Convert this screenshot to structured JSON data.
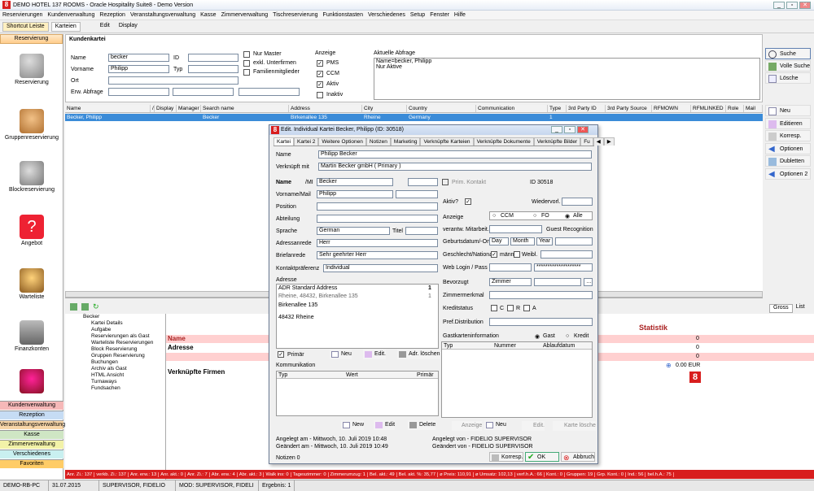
{
  "window": {
    "title": "DEMO HOTEL 137 ROOMS - Oracle Hospitality Suite8 - Demo Version",
    "controls": [
      "_",
      "▫",
      "✕"
    ]
  },
  "menu": [
    "Reservierungen",
    "Kundenverwaltung",
    "Rezeption",
    "Veranstaltungsverwaltung",
    "Kasse",
    "Zimmerverwaltung",
    "Tischreservierung",
    "Funktionstasten",
    "Verschiedenes",
    "Setup",
    "Fenster",
    "Hilfe"
  ],
  "toolbar": {
    "shortcut": "Shortcut Leiste",
    "karteien": "Karteien",
    "edit": "Edit",
    "display": "Display"
  },
  "sidebar": {
    "header": "Reservierung",
    "items": [
      "Reservierung",
      "Gruppenreservierung",
      "Blockreservierung",
      "Angebot",
      "Warteliste",
      "Finanzkonten"
    ],
    "buttons": [
      "Kundenverwaltung",
      "Rezeption",
      "Veranstaltungsverwaltung",
      "Kasse",
      "Zimmerverwaltung",
      "Verschiedenes",
      "Favoriten"
    ],
    "colors": {
      "Kundenverwaltung": "#f6b8b8",
      "Rezeption": "#c6dcf4",
      "Veranstaltungsverwaltung": "#f8d6a8",
      "Kasse": "#cfe6c4",
      "Zimmerverwaltung": "#f2f2a8",
      "Verschiedenes": "#c9f0f0",
      "Favoriten": "#ffcc66"
    }
  },
  "search": {
    "title": "Kundenkartei",
    "name_label": "Name",
    "name_value": "becker",
    "vorname_label": "Vorname",
    "vorname_value": "Philipp",
    "ort_label": "Ort",
    "erw_label": "Erw. Abfrage",
    "id_label": "ID",
    "typ_label": "Typ",
    "nur_master": "Nur Master",
    "exkl_unterfirmen": "exkl. Unterfirmen",
    "familienmitglieder": "Familienmitglieder",
    "anzeige_label": "Anzeige",
    "pms": "PMS",
    "ccm": "CCM",
    "aktiv": "Aktiv",
    "inaktiv": "Inaktiv",
    "aktuelle_label": "Aktuelle Abfrage",
    "aktuelle_line1": "Name=becker, Philipp",
    "aktuelle_line2": "Nur Aktive"
  },
  "right_buttons": [
    "Suche",
    "Volle Suche",
    "Lösche"
  ],
  "right_buttons2": [
    "Neu",
    "Editieren",
    "Korresp.",
    "Optionen",
    "Dubletten",
    "Optionen 2"
  ],
  "grid": {
    "headers": [
      "Name",
      "/",
      "Display",
      "Manager",
      "Search name",
      "Address",
      "City",
      "Country",
      "Communication",
      "Type",
      "3rd Party ID",
      "3rd Party Source",
      "RFMOWN",
      "RFMLINKED",
      "Role",
      "Mail"
    ],
    "row": [
      "Becker, Philipp",
      "",
      "",
      "",
      "Becker",
      "Birkenallee 135",
      "Rheine",
      "Germany",
      "",
      "1",
      "",
      "",
      "",
      "",
      "",
      ""
    ]
  },
  "tree": [
    "Becker",
    "Kartei Details",
    "Aufgabe",
    "Reservierungen als Gast",
    "Warteliste Reservierungen",
    "Block Reservierung",
    "Gruppen Reservierung",
    "Buchungen",
    "Archiv als Gast",
    "HTML Ansicht",
    "Turnaways",
    "Fundsachen"
  ],
  "info": {
    "name": "Name",
    "adresse": "Adresse",
    "firmen": "Verknüpfte Firmen",
    "statistik": "Statistik",
    "tabs": [
      "Gross",
      "List"
    ],
    "val1": "0",
    "val2": "0",
    "val3": "0",
    "val4": "0.00 EUR"
  },
  "status": [
    "Anr. Zi.: 137",
    "verkb. Zi.: 137",
    "Anr. erw.: 13",
    "Anr. akt.: 0",
    "Anr. Zi.: 7",
    "Abr. erw.: 4",
    "Abr. akt.: 3",
    "Walk ins: 0",
    "Tageszimmer: 0",
    "Zimmerumzug: 1",
    "Bel. akt.: 49",
    "Bel. akt. %: 35,77",
    "ø Preis: 110,91",
    "ø Umsatz: 102,13",
    "verf.h.A.: 66",
    "Kont.: 0",
    "Gruppen: 19",
    "Grp. Kont.: 0",
    "Ind.: 56",
    "bel.h.A.: 75"
  ],
  "bottom": [
    "DEMO-RB-PC",
    "31.07.2015",
    "SUPERVISOR, FIDELIO",
    "MOD: SUPERVISOR, FIDELI",
    "Ergebnis: 1"
  ],
  "dialog": {
    "title": "Edit. Individual Kartei Becker, Philipp (ID: 30518)",
    "tabs": [
      "Kartei",
      "Kartei 2",
      "Weitere Optionen",
      "Notizen",
      "Marketing",
      "Verknüpfte Karteien",
      "Verknüpfte Dokumente",
      "Verknüpfte Bilder",
      "Fu"
    ],
    "name_label": "Name",
    "name_value": "Philipp Becker",
    "verk_label": "Verknüpft mit",
    "verk_value": "Martin Becker gmbH ( Primary )",
    "left": {
      "name_l": "Name",
      "mi": "/MI",
      "name_v": "Becker",
      "vorname_l": "Vorname/Mail",
      "vorname_v": "Philipp",
      "position": "Position",
      "abteilung": "Abteilung",
      "sprache_l": "Sprache",
      "sprache_v": "German",
      "titel": "Titel",
      "anrede_l": "Adressanrede",
      "anrede_v": "Herr",
      "brief_l": "Briefanrede",
      "brief_v": "Sehr geehrter Herr",
      "kontakt_l": "Kontaktpräferenz",
      "kontakt_v": "Individual"
    },
    "adresse": {
      "label": "Adresse",
      "row1": "ADR  Standard Address",
      "row1n": "1",
      "row2": "Rheine, 48432, Birkenallee 135",
      "row2n": "1",
      "line1": "Birkenallee 135",
      "line2": "48432 Rheine",
      "primar": "Primär",
      "neu": "Neu",
      "edit": "Edit.",
      "adr_losch": "Adr. löschen"
    },
    "komm": {
      "label": "Kommunikation",
      "typ": "Typ",
      "wert": "Wert",
      "primar": "Primär",
      "neu": "New",
      "edit": "Edit",
      "delete": "Delete"
    },
    "right": {
      "prim": "Prim. Kontakt",
      "id": "ID  30518",
      "aktiv": "Aktiv?",
      "wiedervorl": "Wiedervorl.",
      "anzeige": "Anzeige",
      "ccm": "CCM",
      "fo": "FO",
      "alle": "Alle",
      "verantw": "verantw. Mitarbeit.",
      "guest": "Guest Recognition",
      "geburt": "Geburtsdatum/-Ort",
      "day": "Day",
      "month": "Month",
      "year": "Year",
      "geschlecht": "Geschlecht/National",
      "mann": "männl",
      "weibl": "Weibl.",
      "weblogin": "Web Login / Pass",
      "pass": "********************",
      "bevorzugt": "Bevorzugt",
      "zimmer": "Zimmer",
      "zimmerm": "Zimmermerkmal",
      "kredit": "Kreditstatus",
      "c": "C",
      "r": "R",
      "a": "A",
      "pref": "Pref.Distribution",
      "gast_label": "Gastkarteninformation",
      "gast": "Gast",
      "kredit2": "Kredit",
      "typ": "Typ",
      "nummer": "Nummer",
      "ablauf": "Ablaufdatum",
      "anzeige_btn": "Anzeige",
      "neu": "Neu",
      "edit": "Edit.",
      "karte": "Karte lösche"
    },
    "footer": {
      "notizen": "Notizen 0",
      "angelegt_am": "Angelegt am -   Mittwoch, 10. Juli 2019 10:48",
      "geandert_am": "Geändert am -   Mittwoch, 10. Juli 2019 10:49",
      "angelegt_von": "Angelegt von - FIDELIO SUPERVISOR",
      "geandert_von": "Geändert von - FIDELIO SUPERVISOR",
      "korresp": "Korresp.",
      "ok": "OK",
      "abbruch": "Abbruch"
    }
  }
}
